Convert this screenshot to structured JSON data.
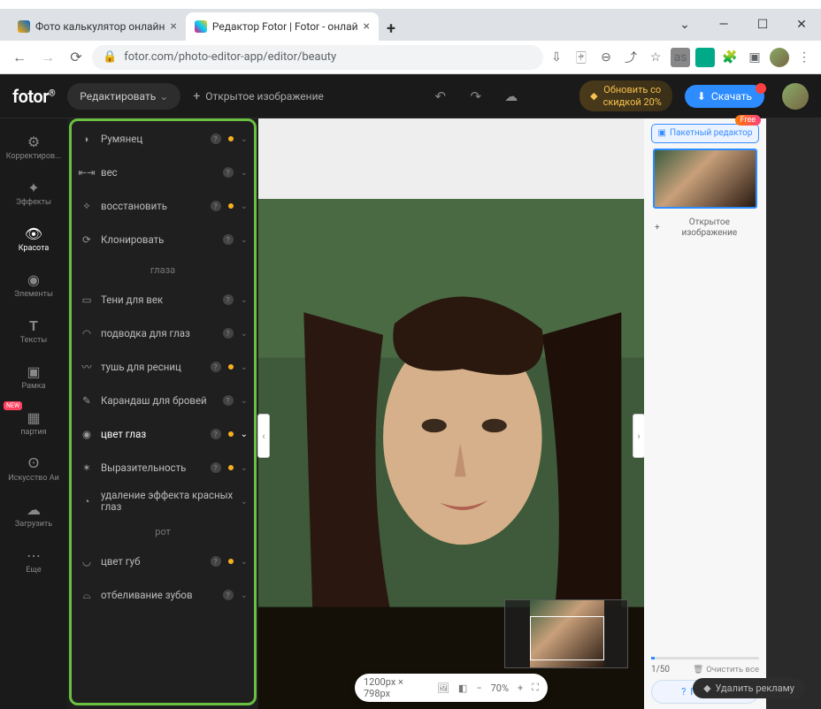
{
  "window": {
    "title_bar": true
  },
  "tabs": [
    {
      "title": "Фото калькулятор онлайн",
      "active": false
    },
    {
      "title": "Редактор Fotor | Fotor - онлай",
      "active": true
    }
  ],
  "url": "fotor.com/photo-editor-app/editor/beauty",
  "header": {
    "logo": "fotor",
    "edit_btn": "Редактировать",
    "open_image": "Открытое изображение",
    "upgrade_line1": "Обновить со",
    "upgrade_line2": "скидкой 20%",
    "download": "Скачать"
  },
  "rail": [
    {
      "id": "adjust",
      "label": "Корректиров..."
    },
    {
      "id": "effects",
      "label": "Эффекты"
    },
    {
      "id": "beauty",
      "label": "Красота",
      "active": true
    },
    {
      "id": "elements",
      "label": "Элементы"
    },
    {
      "id": "text",
      "label": "Тексты"
    },
    {
      "id": "frame",
      "label": "Рамка"
    },
    {
      "id": "party",
      "label": "партия",
      "new": true
    },
    {
      "id": "ai",
      "label": "Искусство Аи"
    },
    {
      "id": "upload",
      "label": "Загрузить"
    },
    {
      "id": "more",
      "label": "Еще"
    }
  ],
  "tools": {
    "items": [
      {
        "label": "Румянец",
        "dot": true
      },
      {
        "label": "вес"
      },
      {
        "label": "восстановить",
        "dot": true
      },
      {
        "label": "Клонировать"
      }
    ],
    "section_eyes": "глаза",
    "eyes": [
      {
        "label": "Тени для век"
      },
      {
        "label": "подводка для глаз"
      },
      {
        "label": "тушь для ресниц",
        "dot": true
      },
      {
        "label": "Карандаш для бровей"
      },
      {
        "label": "цвет глаз",
        "dot": true,
        "active": true
      },
      {
        "label": "Выразительность",
        "dot": true
      },
      {
        "label": "удаление эффекта красных глаз"
      }
    ],
    "section_mouth": "рот",
    "mouth": [
      {
        "label": "цвет губ",
        "dot": true
      },
      {
        "label": "отбеливание зубов"
      }
    ]
  },
  "zoom": {
    "dims": "1200px × 798px",
    "pct": "70%"
  },
  "right": {
    "free": "Free",
    "batch": "Пакетный редактор",
    "open": "Открытое изображение",
    "progress": "1/50",
    "clear": "Очистить все",
    "help": "Помощь"
  },
  "remove_ads": "Удалить рекламу"
}
